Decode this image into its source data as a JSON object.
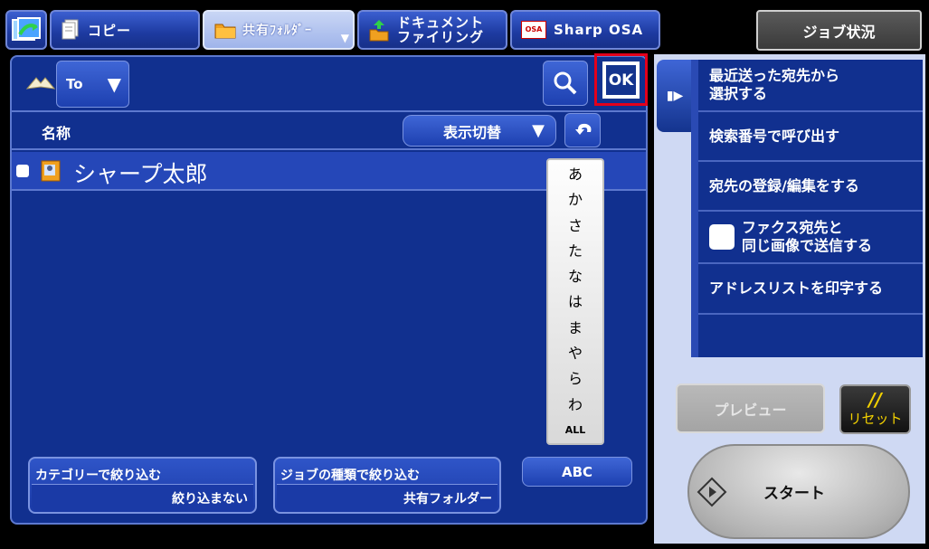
{
  "tabs": {
    "copy": "コピー",
    "shared_folder": "共有ﾌｫﾙﾀﾞｰ",
    "doc_filing_line1": "ドキュメント",
    "doc_filing_line2": "ファイリング",
    "osa_badge": "OSA",
    "sharp_osa": "Sharp OSA",
    "job_status": "ジョブ状況"
  },
  "toolbar": {
    "to_label": "To",
    "ok_label": "OK"
  },
  "list": {
    "header_name": "名称",
    "display_switch": "表示切替",
    "rows": [
      {
        "name": "シャープ太郎"
      }
    ]
  },
  "index": [
    "あ",
    "か",
    "さ",
    "た",
    "な",
    "は",
    "ま",
    "や",
    "ら",
    "わ",
    "ALL"
  ],
  "filters": {
    "category_title": "カテゴリーで絞り込む",
    "category_value": "絞り込まない",
    "jobtype_title": "ジョブの種類で絞り込む",
    "jobtype_value": "共有フォルダー",
    "abc": "ABC"
  },
  "side_menu": {
    "recent_line1": "最近送った宛先から",
    "recent_line2": "選択する",
    "search_number": "検索番号で呼び出す",
    "register_edit": "宛先の登録/編集をする",
    "fax_line1": "ファクス宛先と",
    "fax_line2": "同じ画像で送信する",
    "print_list": "アドレスリストを印字する"
  },
  "actions": {
    "preview": "プレビュー",
    "reset_symbol": "//",
    "reset": "リセット",
    "start": "スタート"
  },
  "colors": {
    "accent": "#1d40b0",
    "background": "#11308f",
    "highlight_border": "#e3001b",
    "reset_text": "#f3d100"
  }
}
